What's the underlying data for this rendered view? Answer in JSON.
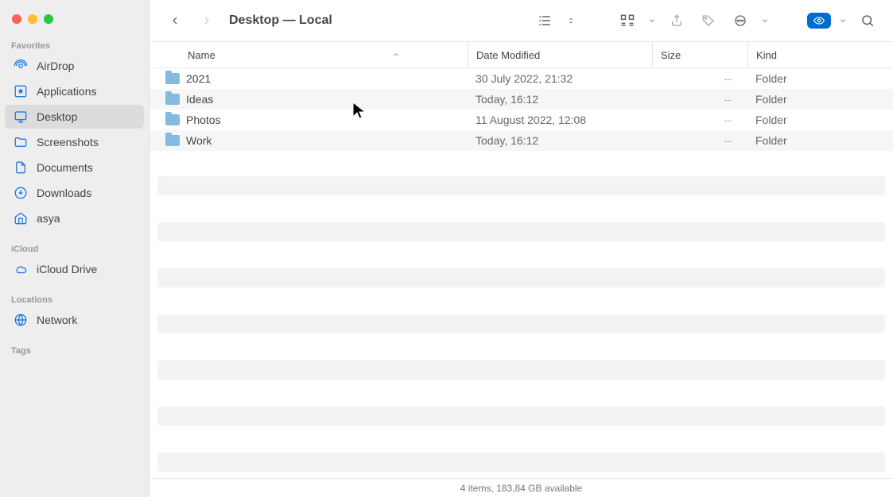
{
  "window": {
    "title": "Desktop — Local",
    "status": "4 items, 183,84 GB available"
  },
  "sidebar": {
    "sections": {
      "favorites_label": "Favorites",
      "icloud_label": "iCloud",
      "locations_label": "Locations",
      "tags_label": "Tags"
    },
    "favorites": [
      {
        "label": "AirDrop"
      },
      {
        "label": "Applications"
      },
      {
        "label": "Desktop"
      },
      {
        "label": "Screenshots"
      },
      {
        "label": "Documents"
      },
      {
        "label": "Downloads"
      },
      {
        "label": "asya"
      }
    ],
    "icloud": [
      {
        "label": "iCloud Drive"
      }
    ],
    "locations": [
      {
        "label": "Network"
      }
    ]
  },
  "columns": {
    "name": "Name",
    "date": "Date Modified",
    "size": "Size",
    "kind": "Kind"
  },
  "rows": [
    {
      "name": "2021",
      "date": "30 July 2022, 21:32",
      "size": "--",
      "kind": "Folder"
    },
    {
      "name": "Ideas",
      "date": "Today, 16:12",
      "size": "--",
      "kind": "Folder"
    },
    {
      "name": "Photos",
      "date": "11 August 2022, 12:08",
      "size": "--",
      "kind": "Folder"
    },
    {
      "name": "Work",
      "date": "Today, 16:12",
      "size": "--",
      "kind": "Folder"
    }
  ]
}
